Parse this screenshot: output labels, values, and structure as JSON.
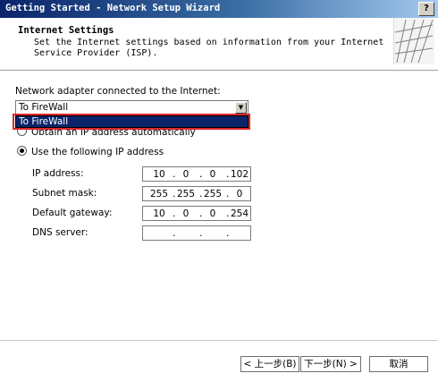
{
  "window": {
    "title": "Getting Started - Network Setup Wizard",
    "help_button": "?"
  },
  "header": {
    "title": "Internet Settings",
    "description": "Set the Internet settings based on information from your Internet Service Provider (ISP)."
  },
  "adapter": {
    "label": "Network adapter connected to the Internet:",
    "selected": "To FireWall",
    "dropdown_open": true,
    "options": [
      "To FireWall"
    ],
    "highlight_color": "#e0262a"
  },
  "ip_mode": {
    "auto_label": "Obtain an IP address automatically",
    "manual_label": "Use the following IP address",
    "selected": "manual"
  },
  "fields": [
    {
      "label": "IP address:",
      "octets": [
        "10",
        "0",
        "0",
        "102"
      ]
    },
    {
      "label": "Subnet mask:",
      "octets": [
        "255",
        "255",
        "255",
        "0"
      ]
    },
    {
      "label": "Default gateway:",
      "octets": [
        "10",
        "0",
        "0",
        "254"
      ]
    },
    {
      "label": "DNS server:",
      "octets": [
        "",
        "",
        "",
        ""
      ]
    }
  ],
  "buttons": {
    "back": "< 上一步(B)",
    "next": "下一步(N) >",
    "cancel": "取消"
  },
  "colors": {
    "title_bar": "#0a246a",
    "selection": "#0a246a"
  }
}
